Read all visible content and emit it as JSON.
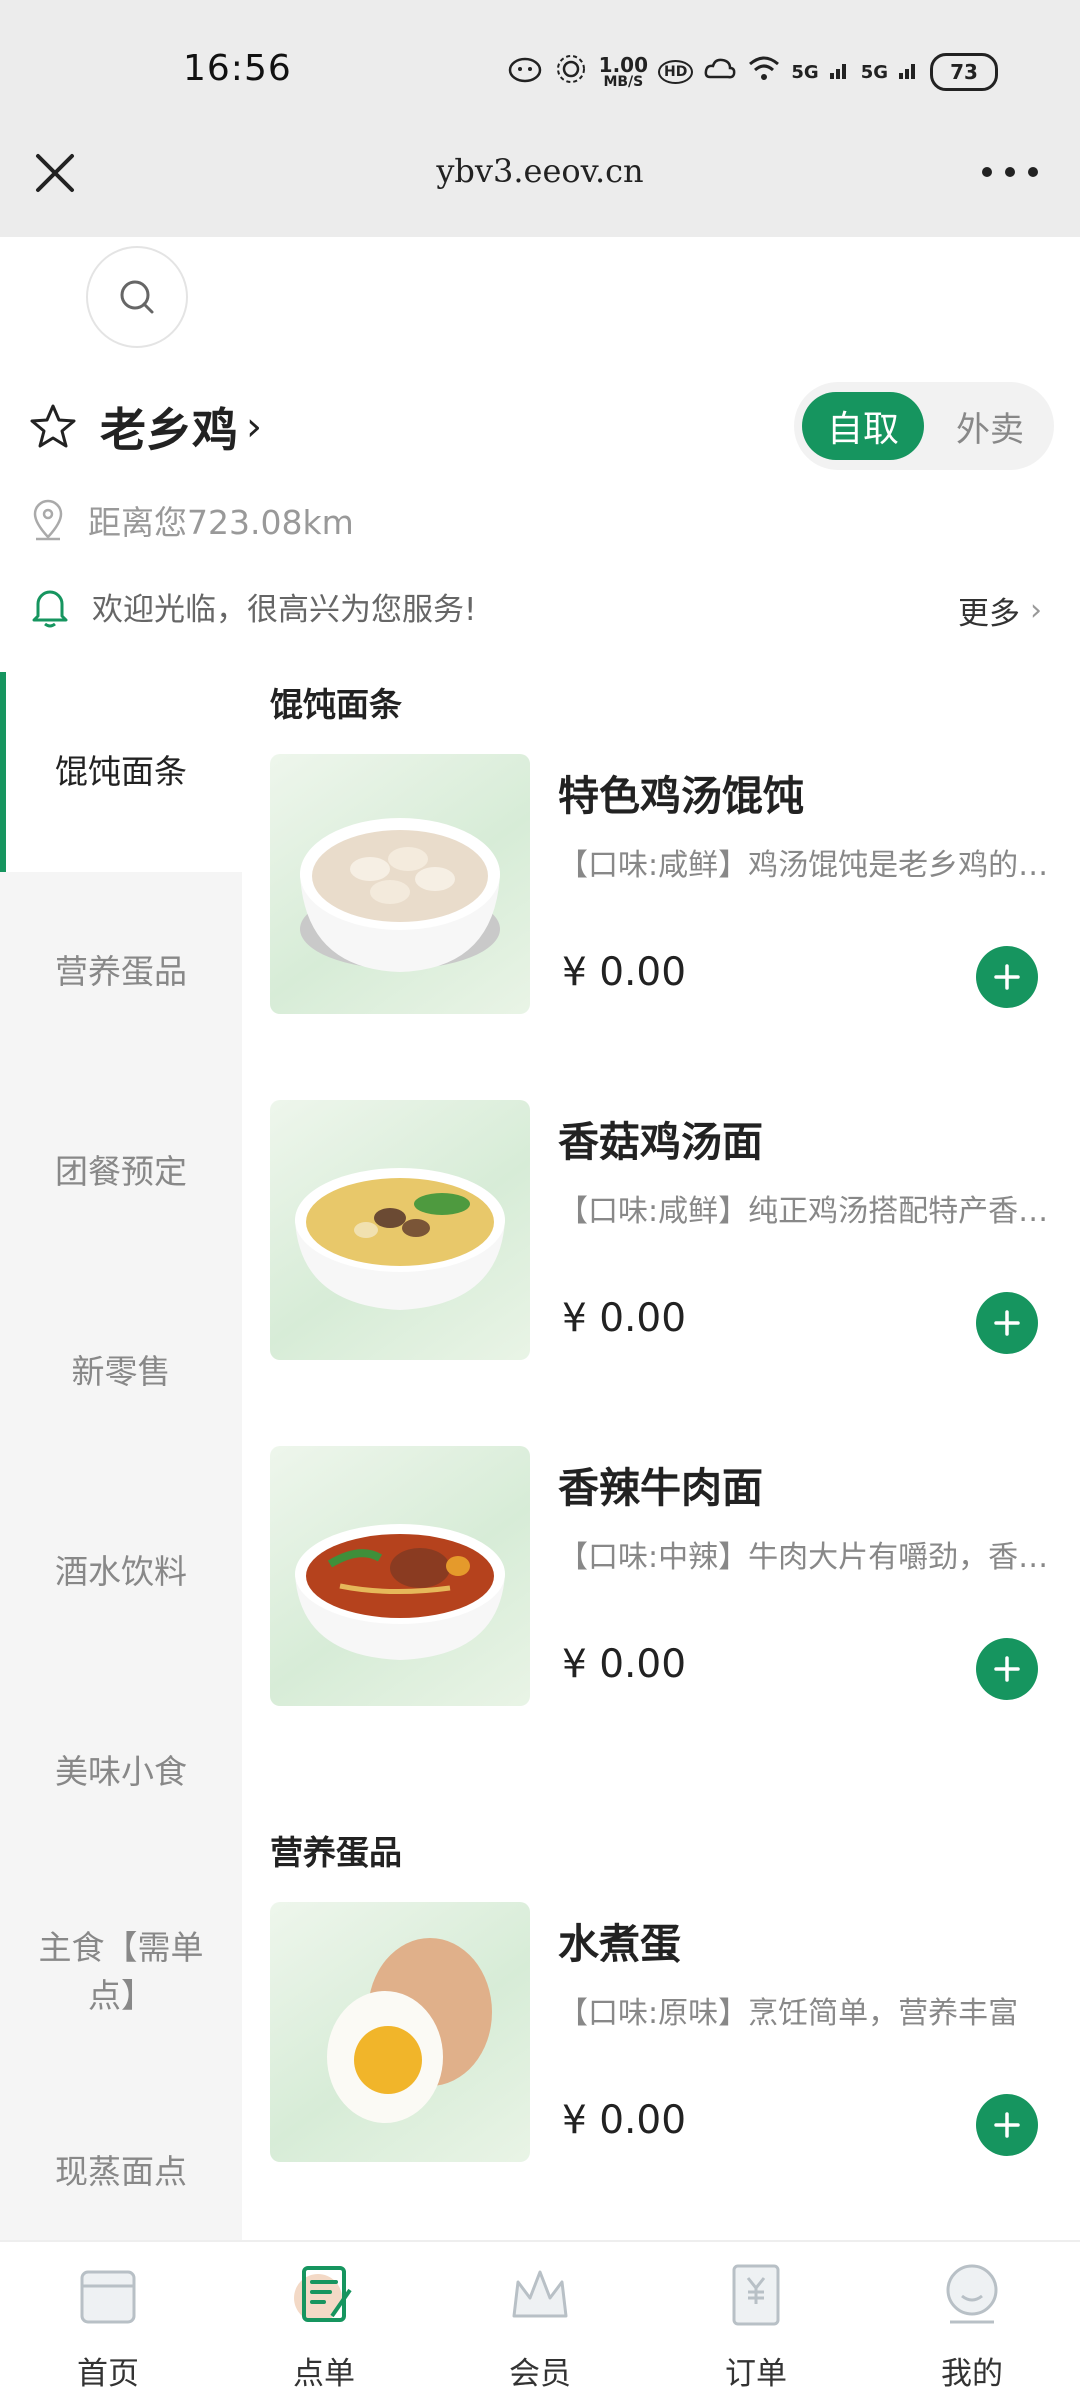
{
  "status_bar": {
    "time": "16:56",
    "net_speed_value": "1.00",
    "net_speed_unit": "MB/S",
    "hd": "HD",
    "sig1": "5G",
    "sig2": "5G",
    "battery": "73"
  },
  "browser": {
    "title": "ybv3.eeov.cn"
  },
  "store": {
    "name": "老乡鸡",
    "distance": "距离您723.08km",
    "notice": "欢迎光临，很高兴为您服务!",
    "notice_more": "更多"
  },
  "mode": {
    "pickup": "自取",
    "delivery": "外卖"
  },
  "categories": [
    "馄饨面条",
    "营养蛋品",
    "团餐预定",
    "新零售",
    "酒水饮料",
    "美味小食",
    "主食【需单点】",
    "现蒸面点"
  ],
  "sections": [
    {
      "title": "馄饨面条",
      "dishes": [
        {
          "name": "特色鸡汤馄饨",
          "desc": "【口味:咸鲜】鸡汤馄饨是老乡鸡的招牌产品，鲜美可口",
          "price": "¥ 0.00"
        },
        {
          "name": "香菇鸡汤面",
          "desc": "【口味:咸鲜】纯正鸡汤搭配特产香菇，汤鲜面滑",
          "price": "¥ 0.00"
        },
        {
          "name": "香辣牛肉面",
          "desc": "【口味:中辣】牛肉大片有嚼劲，香辣过瘾",
          "price": "¥ 0.00"
        }
      ]
    },
    {
      "title": "营养蛋品",
      "dishes": [
        {
          "name": "水煮蛋",
          "desc": "【口味:原味】烹饪简单，营养丰富",
          "price": "¥ 0.00"
        }
      ]
    }
  ],
  "bottom_nav": [
    {
      "label": "首页",
      "icon": "home-icon"
    },
    {
      "label": "点单",
      "icon": "order-menu-icon"
    },
    {
      "label": "会员",
      "icon": "crown-icon"
    },
    {
      "label": "订单",
      "icon": "receipt-icon"
    },
    {
      "label": "我的",
      "icon": "profile-icon"
    }
  ],
  "colors": {
    "accent": "#16955f",
    "statusbar_bg": "#ececec",
    "sidebar_bg": "#f5f5f5"
  }
}
